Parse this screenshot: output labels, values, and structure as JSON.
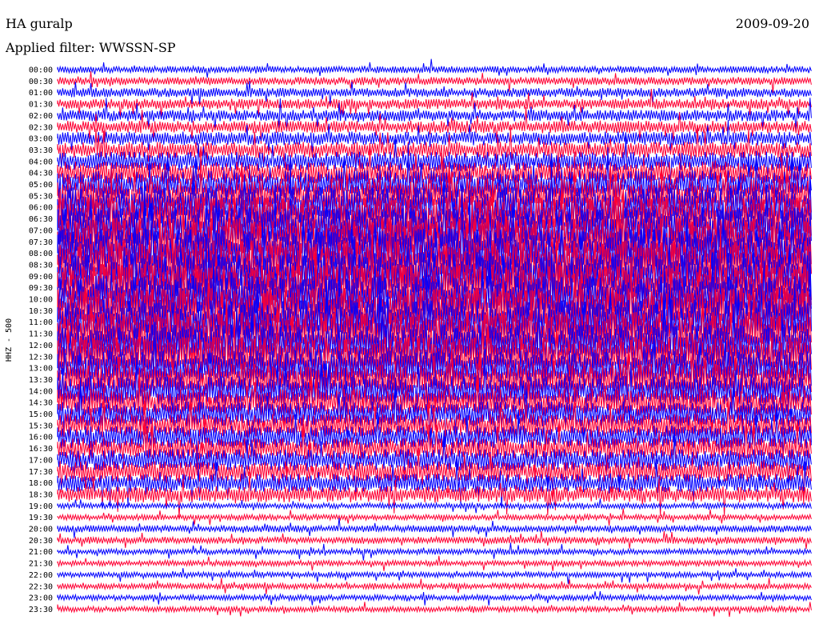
{
  "header": {
    "station": "HA guralp",
    "date": "2009-09-20",
    "filter": "Applied filter: WWSSN-SP"
  },
  "chart_data": {
    "type": "line",
    "title": "HA guralp",
    "subtitle": "Applied filter: WWSSN-SP",
    "ylabel": "HHZ - 500",
    "colors": [
      "#0000ff",
      "#ff0033"
    ],
    "row_labels": [
      "00:00",
      "00:30",
      "01:00",
      "01:30",
      "02:00",
      "02:30",
      "03:00",
      "03:30",
      "04:00",
      "04:30",
      "05:00",
      "05:30",
      "06:00",
      "06:30",
      "07:00",
      "07:30",
      "08:00",
      "08:30",
      "09:00",
      "09:30",
      "10:00",
      "10:30",
      "11:00",
      "11:30",
      "12:00",
      "12:30",
      "13:00",
      "13:30",
      "14:00",
      "14:30",
      "15:00",
      "15:30",
      "16:00",
      "16:30",
      "17:00",
      "17:30",
      "18:00",
      "18:30",
      "19:00",
      "19:30",
      "20:00",
      "20:30",
      "21:00",
      "21:30",
      "22:00",
      "22:30",
      "23:00",
      "23:30"
    ],
    "row_amplitude": [
      0.6,
      0.7,
      0.8,
      0.9,
      1.0,
      1.1,
      1.2,
      1.4,
      1.7,
      2.0,
      2.5,
      3.0,
      3.5,
      3.8,
      4.0,
      4.2,
      4.3,
      4.3,
      4.2,
      4.2,
      4.1,
      4.0,
      3.9,
      3.8,
      3.6,
      3.4,
      3.1,
      2.8,
      2.6,
      2.4,
      2.2,
      2.1,
      2.0,
      1.9,
      1.9,
      1.8,
      1.6,
      1.4,
      0.5,
      0.5,
      0.6,
      0.6,
      0.5,
      0.5,
      0.5,
      0.5,
      0.5,
      0.5
    ]
  }
}
